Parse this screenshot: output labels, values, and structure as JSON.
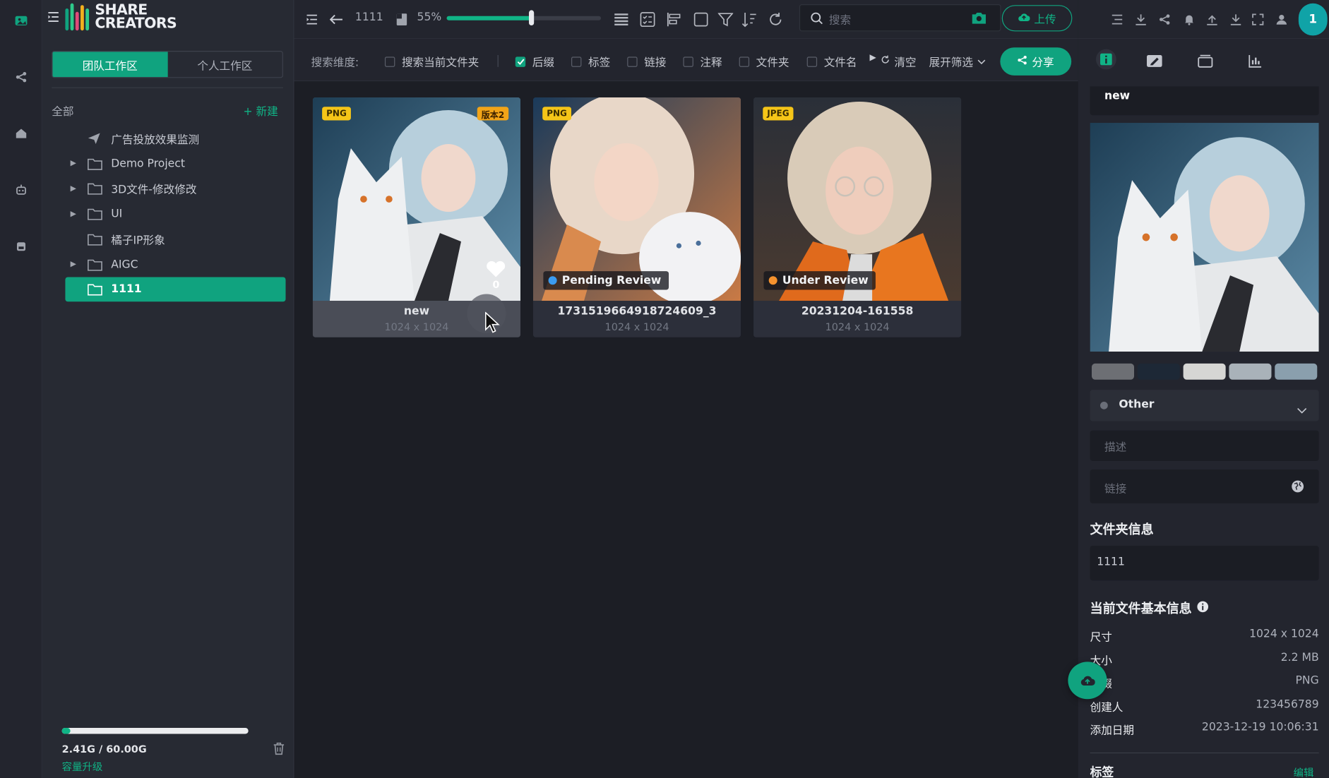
{
  "app": {
    "brand_line1": "SHARE",
    "brand_line2": "CREATORS",
    "avatar_letter": "1"
  },
  "rail": {
    "icons": [
      "image-library-icon",
      "share-icon",
      "home-icon",
      "robot-icon",
      "store-icon"
    ]
  },
  "sidebar": {
    "tabs": [
      {
        "label": "团队工作区",
        "active": true
      },
      {
        "label": "个人工作区",
        "active": false
      }
    ],
    "all_label": "全部",
    "new_label": "+ 新建",
    "tree": [
      {
        "label": "广告投放效果监测",
        "icon": "paper-plane-icon",
        "expandable": false,
        "selected": false
      },
      {
        "label": "Demo Project",
        "icon": "folder-icon",
        "expandable": true,
        "selected": false
      },
      {
        "label": "3D文件-修改修改",
        "icon": "folder-icon",
        "expandable": true,
        "selected": false
      },
      {
        "label": "UI",
        "icon": "folder-icon",
        "expandable": true,
        "selected": false
      },
      {
        "label": "橘子IP形象",
        "icon": "folder-icon",
        "expandable": false,
        "selected": false
      },
      {
        "label": "AIGC",
        "icon": "folder-icon",
        "expandable": true,
        "selected": false
      },
      {
        "label": "1111",
        "icon": "folder-icon",
        "expandable": false,
        "selected": true
      }
    ],
    "storage": {
      "text": "2.41G / 60.00G",
      "used_fraction": 0.04,
      "upgrade_label": "容量升级"
    }
  },
  "toolbar": {
    "folder_name": "1111",
    "zoom_label": "55%",
    "zoom_fraction": 0.55,
    "search_placeholder": "搜索",
    "upload_label": "上传"
  },
  "filter": {
    "label": "搜索维度:",
    "options": [
      {
        "label": "搜索当前文件夹",
        "checked": false
      },
      {
        "label": "后缀",
        "checked": true
      },
      {
        "label": "标签",
        "checked": false
      },
      {
        "label": "链接",
        "checked": false
      },
      {
        "label": "注释",
        "checked": false
      },
      {
        "label": "文件夹",
        "checked": false
      },
      {
        "label": "文件名",
        "checked": false
      }
    ],
    "clear_label": "清空",
    "expand_label": "展开筛选",
    "share_label": "分享"
  },
  "files": [
    {
      "format": "PNG",
      "version": "版本2",
      "name": "new",
      "dims": "1024 x 1024",
      "likes": "0",
      "status": ""
    },
    {
      "format": "PNG",
      "version": "",
      "name": "1731519664918724609_3",
      "dims": "1024 x 1024",
      "status": "Pending Review",
      "status_color": "#3b9cf0"
    },
    {
      "format": "JPEG",
      "version": "",
      "name": "20231204-161558",
      "dims": "1024 x 1024",
      "status": "Under Review",
      "status_color": "#f5922e"
    }
  ],
  "panel": {
    "file_name": "new",
    "palette": [
      "#6d6f74",
      "#1d2836",
      "#d6d6d4",
      "#a9b2b9",
      "#8a9fad"
    ],
    "category": "Other",
    "desc_placeholder": "描述",
    "link_placeholder": "链接",
    "folder_info_title": "文件夹信息",
    "folder_name": "1111",
    "basic_info_title": "当前文件基本信息",
    "rows": [
      {
        "k": "尺寸",
        "v": "1024 x 1024"
      },
      {
        "k": "大小",
        "v": "2.2 MB"
      },
      {
        "k": "后缀",
        "v": "PNG"
      },
      {
        "k": "创建人",
        "v": "123456789"
      },
      {
        "k": "添加日期",
        "v": "2023-12-19 10:06:31"
      }
    ],
    "tags_title": "标签",
    "tags_action": "编辑"
  }
}
